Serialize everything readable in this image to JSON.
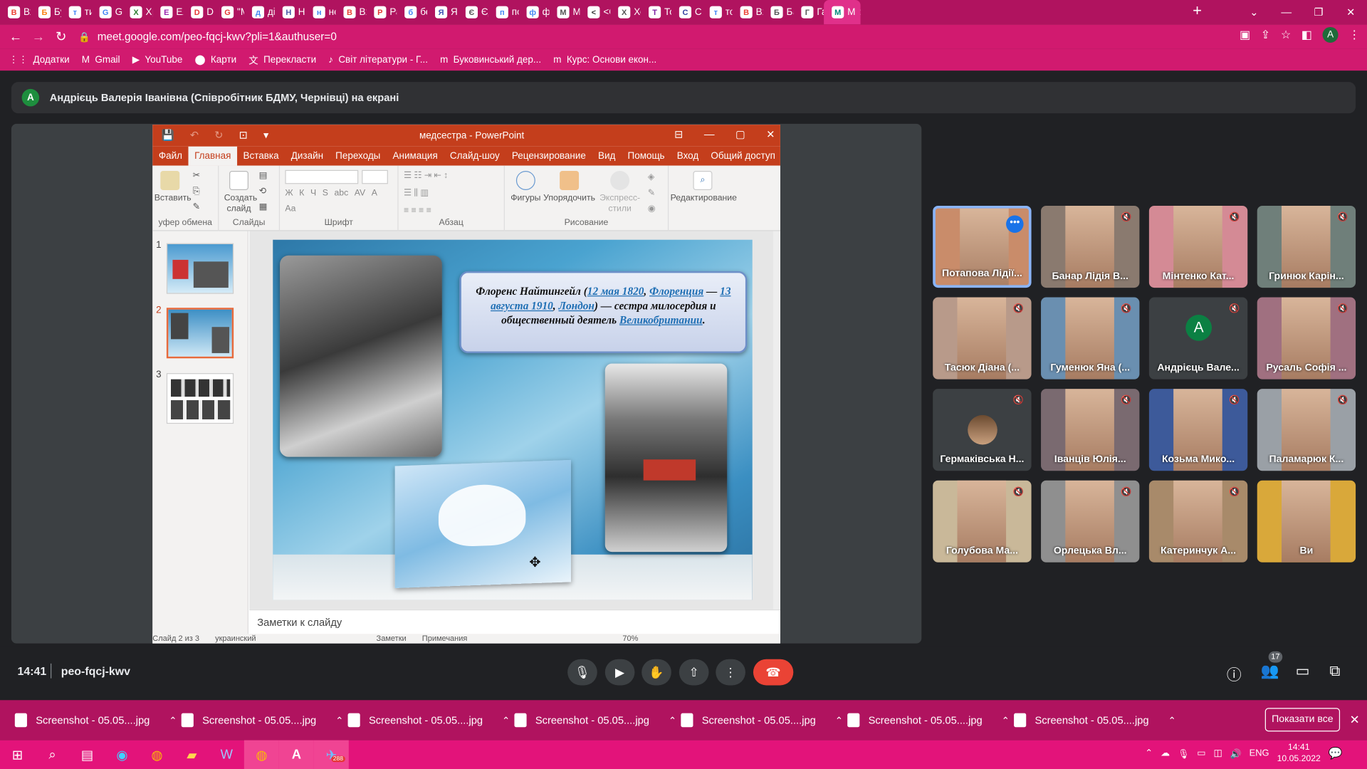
{
  "browser": {
    "tabs": [
      {
        "label": "Вхі",
        "icon": "gmail-icon",
        "color": "#ea4335"
      },
      {
        "label": "Бук",
        "icon": "moodle-icon",
        "color": "#f98012"
      },
      {
        "label": "тир",
        "icon": "google-icon",
        "color": "#4285f4"
      },
      {
        "label": "Go",
        "icon": "translate-icon",
        "color": "#4285f4"
      },
      {
        "label": "Хр",
        "icon": "prometheus-icon",
        "color": "#2e7d32"
      },
      {
        "label": "Еле",
        "icon": "elearning-icon",
        "color": "#9c27b0"
      },
      {
        "label": "Do",
        "icon": "doc-icon",
        "color": "#e53935"
      },
      {
        "label": "\"M",
        "icon": "g-icon",
        "color": "#e53935"
      },
      {
        "label": "діа",
        "icon": "google-icon",
        "color": "#4285f4"
      },
      {
        "label": "На",
        "icon": "nai-icon",
        "color": "#4a5aa8"
      },
      {
        "label": "неї",
        "icon": "google-icon",
        "color": "#4285f4"
      },
      {
        "label": "Вхі",
        "icon": "gmail-icon",
        "color": "#ea4335"
      },
      {
        "label": "Ра",
        "icon": "c-icon",
        "color": "#e53935"
      },
      {
        "label": "бес",
        "icon": "google-icon",
        "color": "#4285f4"
      },
      {
        "label": "Які",
        "icon": "ask-icon",
        "color": "#3f51b5"
      },
      {
        "label": "Єд",
        "icon": "wikipedia-icon",
        "color": "#555"
      },
      {
        "label": "по",
        "icon": "google-icon",
        "color": "#4285f4"
      },
      {
        "label": "фе",
        "icon": "google-icon",
        "color": "#4285f4"
      },
      {
        "label": "Ме",
        "icon": "wikipedia-icon",
        "color": "#555"
      },
      {
        "label": "<С",
        "icon": "s-icon",
        "color": "#333"
      },
      {
        "label": "Хо",
        "icon": "wikipedia-icon",
        "color": "#555"
      },
      {
        "label": "Тог",
        "icon": "tor-icon",
        "color": "#7b1fa2"
      },
      {
        "label": "Спі",
        "icon": "star-icon",
        "color": "#303f9f"
      },
      {
        "label": "тов",
        "icon": "google-icon",
        "color": "#4285f4"
      },
      {
        "label": "Вхі",
        "icon": "gmail-icon",
        "color": "#ea4335"
      },
      {
        "label": "Бат",
        "icon": "wikipedia-icon",
        "color": "#555"
      },
      {
        "label": "Гас",
        "icon": "wikipedia-icon",
        "color": "#555"
      },
      {
        "label": "М",
        "icon": "meet-icon",
        "color": "#00897b"
      }
    ],
    "url": "meet.google.com/peo-fqcj-kwv?pli=1&authuser=0",
    "profile_initial": "A",
    "bookmarks": [
      {
        "label": "Додатки",
        "icon": "apps-icon"
      },
      {
        "label": "Gmail",
        "icon": "gmail-icon"
      },
      {
        "label": "YouTube",
        "icon": "youtube-icon"
      },
      {
        "label": "Карти",
        "icon": "maps-icon"
      },
      {
        "label": "Перекласти",
        "icon": "translate-icon"
      },
      {
        "label": "Світ літератури - Г...",
        "icon": "bookmark-icon"
      },
      {
        "label": "Буковинський дер...",
        "icon": "moodle-icon"
      },
      {
        "label": "Курс: Основи екон...",
        "icon": "moodle-icon"
      }
    ]
  },
  "meet": {
    "presenter_initial": "A",
    "presenter_banner": "Андрієць Валерія Іванівна (Співробітник БДМУ, Чернівці) на екрані",
    "clock": "14:41",
    "meeting_code": "peo-fqcj-kwv",
    "participant_count": "17",
    "participants": [
      {
        "name": "Потапова Лідії...",
        "speaking": true,
        "more": "•••"
      },
      {
        "name": "Банар Лідія В...",
        "muted": true
      },
      {
        "name": "Мінтенко Кат...",
        "muted": true
      },
      {
        "name": "Гринюк Карін...",
        "muted": true
      },
      {
        "name": "Тасюк Діана (...",
        "muted": true
      },
      {
        "name": "Гуменюк Яна (...",
        "muted": true
      },
      {
        "name": "Андрієць Вале...",
        "muted": true,
        "avatar": "A"
      },
      {
        "name": "Русаль Софія ...",
        "muted": true
      },
      {
        "name": "Гермаківська Н...",
        "muted": true,
        "avatar_photo": true
      },
      {
        "name": "Іванців Юлія...",
        "muted": true
      },
      {
        "name": "Козьма Мико...",
        "muted": true
      },
      {
        "name": "Паламарюк К...",
        "muted": true
      },
      {
        "name": "Голубова Ма...",
        "muted": true
      },
      {
        "name": "Орлецька Вл...",
        "muted": true
      },
      {
        "name": "Катеринчук А...",
        "muted": true
      },
      {
        "name": "Ви",
        "muted": false
      }
    ]
  },
  "powerpoint": {
    "title": "медсестра - PowerPoint",
    "menu": [
      "Файл",
      "Главная",
      "Вставка",
      "Дизайн",
      "Переходы",
      "Анимация",
      "Слайд-шоу",
      "Рецензирование",
      "Вид",
      "Помощь",
      "Вход",
      "Общий доступ"
    ],
    "active_menu": "Главная",
    "ribbon": {
      "paste": "Вставить",
      "clipboard": "уфер обмена",
      "new_slide": "Создать слайд",
      "slides": "Слайды",
      "font": "Шрифт",
      "paragraph": "Абзац",
      "shapes": "Фигуры",
      "arrange": "Упорядочить",
      "quick_styles": "Экспресс-стили",
      "drawing": "Рисование",
      "editing": "Редактирование",
      "font_buttons": [
        "Ж",
        "К",
        "Ч",
        "S",
        "abc",
        "AV",
        "A",
        "Aa"
      ]
    },
    "slide_numbers": [
      "1",
      "2",
      "3"
    ],
    "slide_text": {
      "name": "Флоренс Найтингейл",
      "date1": "12 мая 1820",
      "city1": "Флоренция",
      "date2": "13 августа 1910",
      "city2": "Лондон",
      "desc": " — сестра милосердия и общественный деятель ",
      "country": "Великобритании"
    },
    "notes_placeholder": "Заметки к слайду",
    "status": {
      "slide": "Слайд 2 из 3",
      "lang": "украинский",
      "notes": "Заметки",
      "comments": "Примечания",
      "zoom": "70%"
    }
  },
  "downloads": {
    "items": [
      "Screenshot - 05.05....jpg",
      "Screenshot - 05.05....jpg",
      "Screenshot - 05.05....jpg",
      "Screenshot - 05.05....jpg",
      "Screenshot - 05.05....jpg",
      "Screenshot - 05.05....jpg",
      "Screenshot - 05.05....jpg"
    ],
    "show_all": "Показати все"
  },
  "taskbar": {
    "lang": "ENG",
    "time": "14:41",
    "date": "10.05.2022",
    "telegram_badge": "288"
  }
}
